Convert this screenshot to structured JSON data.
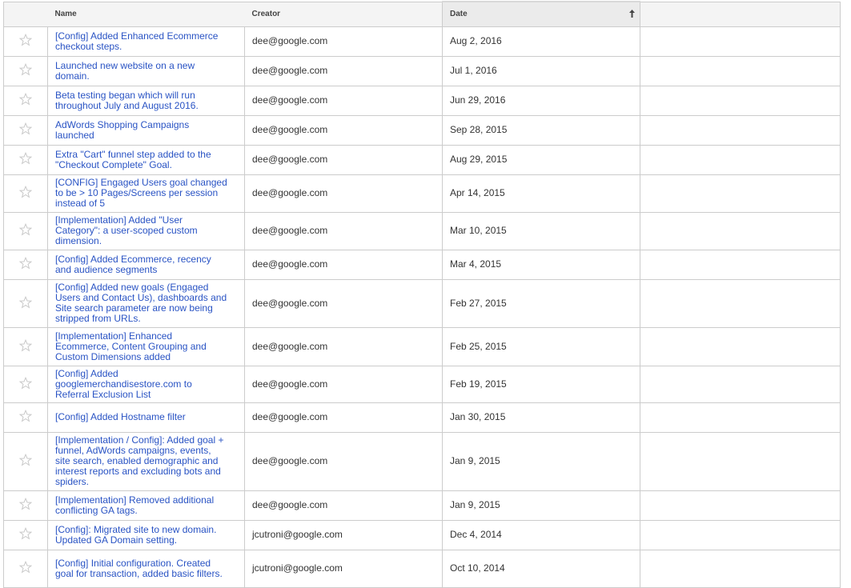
{
  "table": {
    "headers": {
      "star": "",
      "name": "Name",
      "creator": "Creator",
      "date": "Date",
      "extra": ""
    },
    "sort": {
      "column": "date",
      "icon": "sort-arrow-icon",
      "glyph": "🠕"
    },
    "accent_link_color": "#2953c4",
    "rows": [
      {
        "name": "[Config] Added Enhanced Ecommerce checkout steps.",
        "creator": "dee@google.com",
        "date": "Aug 2, 2016",
        "starred": false
      },
      {
        "name": "Launched new website on a new domain.",
        "creator": "dee@google.com",
        "date": "Jul 1, 2016",
        "starred": false
      },
      {
        "name": "Beta testing began which will run throughout July and August 2016.",
        "creator": "dee@google.com",
        "date": "Jun 29, 2016",
        "starred": false
      },
      {
        "name": "AdWords Shopping Campaigns launched",
        "creator": "dee@google.com",
        "date": "Sep 28, 2015",
        "starred": false
      },
      {
        "name": "Extra \"Cart\" funnel step added to the \"Checkout Complete\" Goal.",
        "creator": "dee@google.com",
        "date": "Aug 29, 2015",
        "starred": false
      },
      {
        "name": "[CONFIG] Engaged Users goal changed to be > 10 Pages/Screens per session instead of 5",
        "creator": "dee@google.com",
        "date": "Apr 14, 2015",
        "starred": false
      },
      {
        "name": "[Implementation] Added \"User Category\": a user-scoped custom dimension.",
        "creator": "dee@google.com",
        "date": "Mar 10, 2015",
        "starred": false
      },
      {
        "name": "[Config] Added Ecommerce, recency and audience segments",
        "creator": "dee@google.com",
        "date": "Mar 4, 2015",
        "starred": false
      },
      {
        "name": "[Config] Added new goals (Engaged Users and Contact Us), dashboards and Site search parameter are now being stripped from URLs.",
        "creator": "dee@google.com",
        "date": "Feb 27, 2015",
        "starred": false
      },
      {
        "name": "[Implementation] Enhanced Ecommerce, Content Grouping and Custom Dimensions added",
        "creator": "dee@google.com",
        "date": "Feb 25, 2015",
        "starred": false
      },
      {
        "name": "[Config] Added googlemerchandisestore.com to Referral Exclusion List",
        "creator": "dee@google.com",
        "date": "Feb 19, 2015",
        "starred": false
      },
      {
        "name": "[Config] Added Hostname filter",
        "creator": "dee@google.com",
        "date": "Jan 30, 2015",
        "starred": false
      },
      {
        "name": "[Implementation / Config]: Added goal + funnel, AdWords campaigns, events, site search, enabled demographic and interest reports and excluding bots and spiders.",
        "creator": "dee@google.com",
        "date": "Jan 9, 2015",
        "starred": false
      },
      {
        "name": "[Implementation] Removed additional conflicting GA tags.",
        "creator": "dee@google.com",
        "date": "Jan 9, 2015",
        "starred": false
      },
      {
        "name": "[Config]: Migrated site to new domain. Updated GA Domain setting.",
        "creator": "jcutroni@google.com",
        "date": "Dec 4, 2014",
        "starred": false
      },
      {
        "name": "[Config] Initial configuration. Created goal for transaction, added basic filters.",
        "creator": "jcutroni@google.com",
        "date": "Oct 10, 2014",
        "starred": false
      }
    ]
  }
}
